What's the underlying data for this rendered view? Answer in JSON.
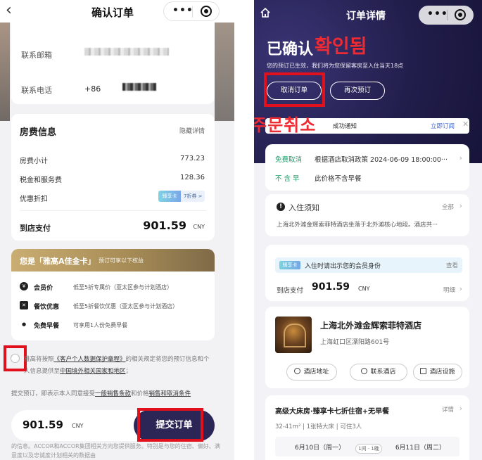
{
  "left": {
    "header": {
      "back": "‹",
      "title": "确认订单"
    },
    "contact": {
      "email_label": "联系邮箱",
      "phone_label": "联系电话",
      "phone_prefix": "+86"
    },
    "fees": {
      "title": "房费信息",
      "hide_label": "隐藏详情",
      "rows": [
        {
          "label": "房费小计",
          "value": "773.23"
        },
        {
          "label": "税金和服务费",
          "value": "128.36"
        },
        {
          "label": "优惠折扣",
          "value": ""
        }
      ],
      "discount_badge": "臻享卡",
      "discount_rate": "7折券 >",
      "pay_label": "到店支付",
      "pay_value": "901.59",
      "pay_unit": "CNY"
    },
    "gold": {
      "title": "您是「雅高A佳金卡」",
      "subtitle": "预订可享以下权益",
      "benefits": [
        {
          "icon": "¥",
          "name": "会员价",
          "desc": "低至5折专属价（亚太区参与计划酒店）"
        },
        {
          "icon": "✕",
          "name": "餐饮优惠",
          "desc": "低至5折餐饮优惠（亚太区参与计划酒店）"
        },
        {
          "icon": "●",
          "name": "免费早餐",
          "desc": "可享用1人份免费早餐"
        }
      ]
    },
    "consent": {
      "part1": "雅高将按照",
      "link1": "《客户个人数据保护章程》",
      "part2": "的相关规定将您的预订信息和个人信息提供至",
      "link2": "中国境外相关国家和地区",
      "part3": "；"
    },
    "terms": {
      "part1": "提交预订，即表示本人同意接受",
      "link1": "一般销售条款",
      "part2": "和价格",
      "link2": "销售和取消条件"
    },
    "bottom": {
      "price": "901.59",
      "unit": "CNY",
      "submit": "提交订单"
    },
    "disclaimer": "的信息。ACCOR和ACCOR集团相关方向您提供服务。特别是与您的住宿、偏好、满意度以及忠诚度计划相关的数据由"
  },
  "right": {
    "header": {
      "title": "订单详情"
    },
    "status": "已确认",
    "status_kr": "확인됨",
    "subtitle": "您的预订已生效，我们将为您保留客房至入住当天18点",
    "buttons": {
      "cancel": "取消订单",
      "rebook": "再次预订"
    },
    "cancel_kr": "주문취소",
    "notice": {
      "text": "成功通知",
      "action": "立即订阅",
      "close": "✕"
    },
    "policy": {
      "cancel_tag": "免费取消",
      "cancel_text": "根据酒店取消政策 2024-06-09 18:00:00···",
      "breakfast_tag": "不 含 早",
      "breakfast_text": "此价格不含早餐"
    },
    "checkin": {
      "title": "入住须知",
      "all": "全部",
      "text": "上海北外滩金辉索菲特酒店坐落于北外滩核心地段。酒店共···"
    },
    "payment": {
      "badge": "臻享卡",
      "member_text": "入住时请出示您的会员身份",
      "view": "查看",
      "pay_label": "到店支付",
      "pay_value": "901.59",
      "pay_unit": "CNY",
      "detail": "明细"
    },
    "hotel": {
      "name": "上海北外滩金辉索菲特酒店",
      "address": "上海虹口区溧阳路601号",
      "buttons": [
        "酒店地址",
        "联系酒店",
        "酒店设施"
      ]
    },
    "room": {
      "name": "高级大床房·臻享卡七折住宿+无早餐",
      "detail": "详情",
      "meta": "32-41m²  |  1张特大床  |  可住3人",
      "checkin": "6月10日（周一）",
      "nights": "1间 · 1晚",
      "checkout": "6月11日（周二）"
    }
  }
}
